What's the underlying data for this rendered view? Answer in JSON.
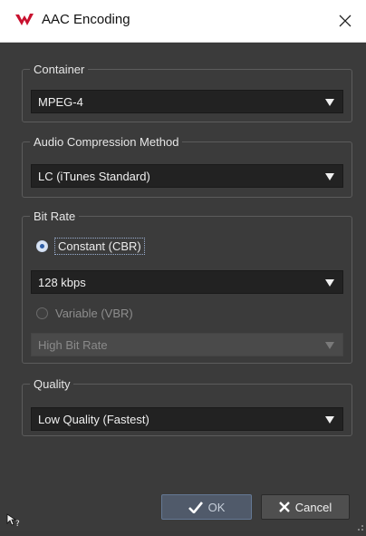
{
  "window": {
    "title": "AAC Encoding"
  },
  "container": {
    "legend": "Container",
    "value": "MPEG-4"
  },
  "compression": {
    "legend": "Audio Compression Method",
    "value": "LC (iTunes Standard)"
  },
  "bitrate": {
    "legend": "Bit Rate",
    "constant_label": "Constant (CBR)",
    "constant_value": "128 kbps",
    "variable_label": "Variable (VBR)",
    "variable_value": "High Bit Rate",
    "selected": "constant"
  },
  "quality": {
    "legend": "Quality",
    "value": "Low Quality (Fastest)"
  },
  "buttons": {
    "ok_label": "OK",
    "cancel_label": "Cancel"
  },
  "colors": {
    "background": "#3b3b3b",
    "combo_background": "#222222",
    "accent": "#2f5fa8",
    "title_bar": "#ffffff",
    "app_logo": "#c8102e"
  },
  "icons": {
    "app": "app-logo-icon",
    "close": "close-icon",
    "ok": "checkmark-icon",
    "cancel": "x-icon",
    "help": "help-cursor-icon",
    "resize": "resize-grip-icon"
  }
}
